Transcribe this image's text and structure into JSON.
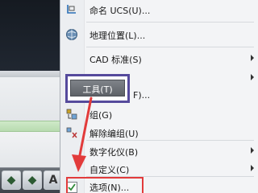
{
  "menu": {
    "items": [
      {
        "label": "命名 UCS(U)...",
        "icon": "ucs-named-icon",
        "submenu": false
      },
      {
        "label": "地理位置(L)...",
        "icon": "globe-icon",
        "submenu": false
      },
      {
        "label": "CAD 标准(S)",
        "icon": "",
        "submenu": true
      },
      {
        "label": "工具(T)",
        "icon": "",
        "submenu": false,
        "highlighted": true
      },
      {
        "label": "组(G)",
        "icon": "group-icon",
        "submenu": false
      },
      {
        "label": "解除编组(U)",
        "icon": "ungroup-icon",
        "submenu": false
      },
      {
        "label": "数字化仪(B)",
        "icon": "",
        "submenu": true
      },
      {
        "label": "自定义(C)",
        "icon": "",
        "submenu": true
      },
      {
        "label": "选项(N)...",
        "icon": "options-check-icon",
        "submenu": false,
        "selected": true
      }
    ],
    "peek_text": "F)..."
  },
  "toolbar": {
    "buttons": [
      "green-app-icon",
      "green-app-icon",
      "text-style-icon"
    ]
  },
  "colors": {
    "highlight_border": "#554a9c",
    "selection_border": "#e23b3b",
    "annotation_arrow": "#e23b3b"
  }
}
